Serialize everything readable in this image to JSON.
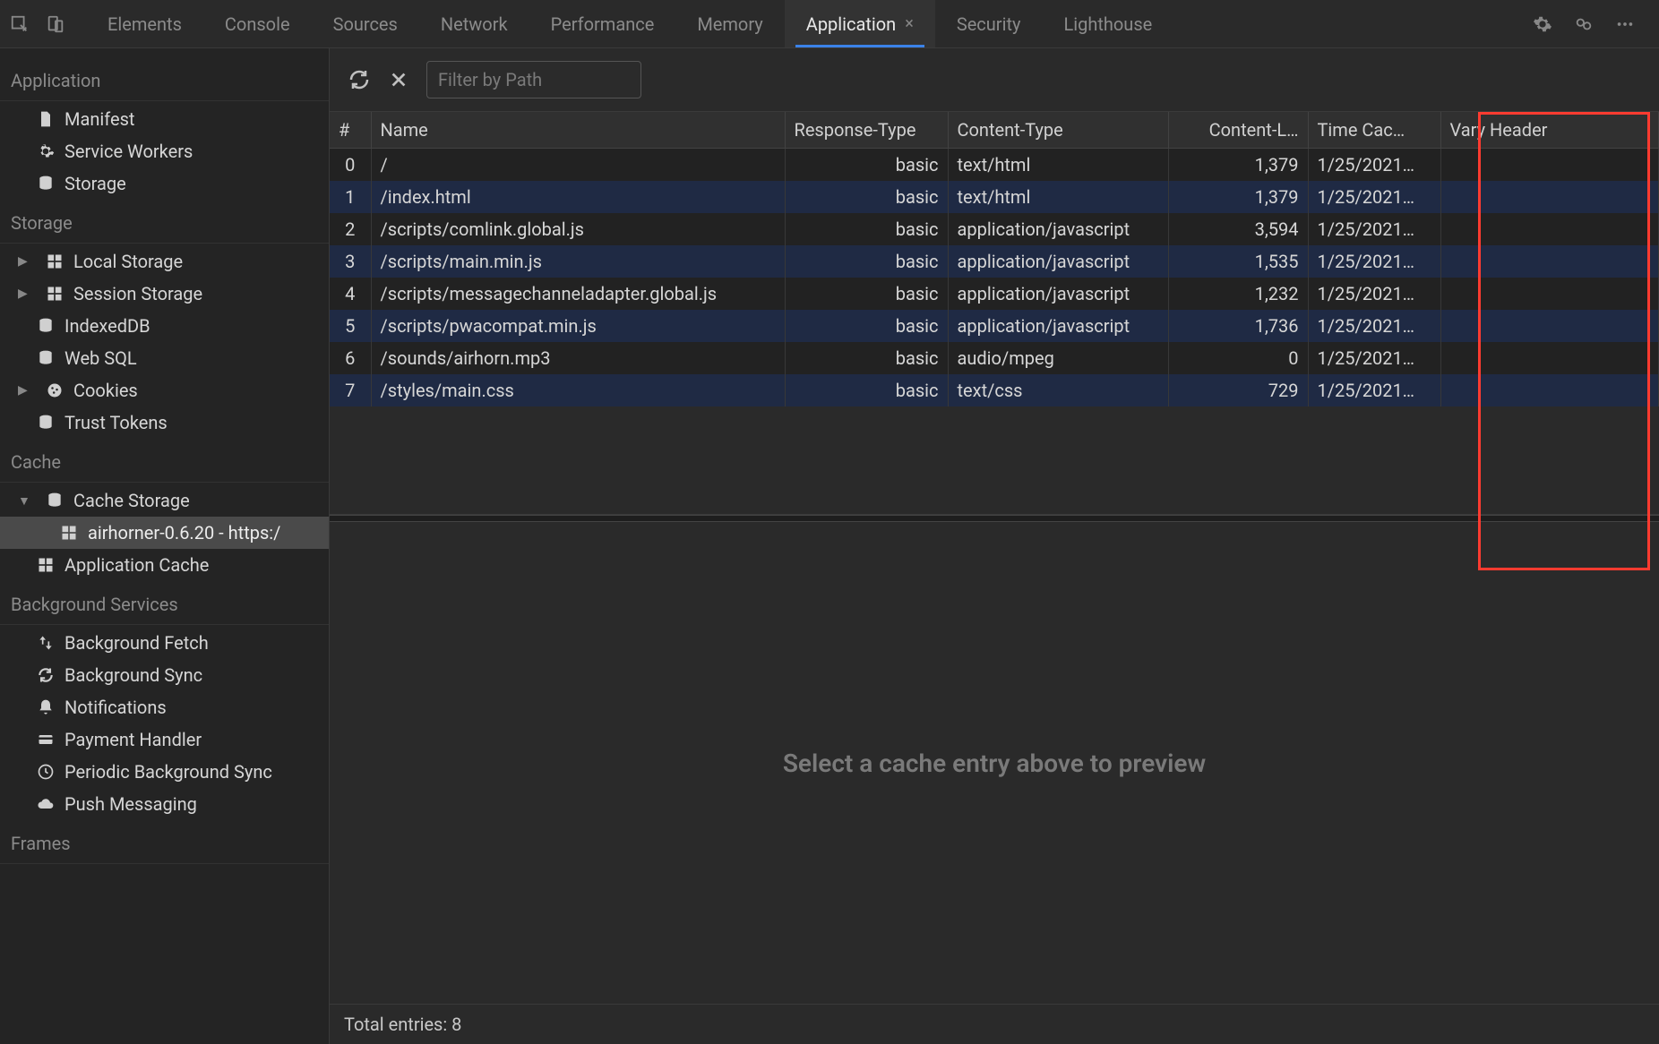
{
  "tabs": [
    "Elements",
    "Console",
    "Sources",
    "Network",
    "Performance",
    "Memory",
    "Application",
    "Security",
    "Lighthouse"
  ],
  "active_tab": "Application",
  "sidebar": {
    "sections": [
      {
        "title": "Application",
        "items": [
          {
            "icon": "file",
            "label": "Manifest"
          },
          {
            "icon": "gear",
            "label": "Service Workers"
          },
          {
            "icon": "db",
            "label": "Storage"
          }
        ]
      },
      {
        "title": "Storage",
        "items": [
          {
            "icon": "grid",
            "label": "Local Storage",
            "expandable": true
          },
          {
            "icon": "grid",
            "label": "Session Storage",
            "expandable": true
          },
          {
            "icon": "db",
            "label": "IndexedDB"
          },
          {
            "icon": "db",
            "label": "Web SQL"
          },
          {
            "icon": "cookie",
            "label": "Cookies",
            "expandable": true
          },
          {
            "icon": "db",
            "label": "Trust Tokens"
          }
        ]
      },
      {
        "title": "Cache",
        "items": [
          {
            "icon": "db",
            "label": "Cache Storage",
            "expandable": true,
            "expanded": true,
            "children": [
              {
                "icon": "grid",
                "label": "airhorner-0.6.20 - https:/",
                "selected": true
              }
            ]
          },
          {
            "icon": "grid",
            "label": "Application Cache"
          }
        ]
      },
      {
        "title": "Background Services",
        "items": [
          {
            "icon": "updown",
            "label": "Background Fetch"
          },
          {
            "icon": "sync",
            "label": "Background Sync"
          },
          {
            "icon": "bell",
            "label": "Notifications"
          },
          {
            "icon": "card",
            "label": "Payment Handler"
          },
          {
            "icon": "clock",
            "label": "Periodic Background Sync"
          },
          {
            "icon": "cloud",
            "label": "Push Messaging"
          }
        ]
      },
      {
        "title": "Frames",
        "items": []
      }
    ]
  },
  "toolbar": {
    "filter_placeholder": "Filter by Path"
  },
  "table": {
    "columns": [
      "#",
      "Name",
      "Response-Type",
      "Content-Type",
      "Content-L…",
      "Time Cac…",
      "Vary Header"
    ],
    "rows": [
      {
        "idx": "0",
        "name": "/",
        "resp": "basic",
        "ctype": "text/html",
        "clen": "1,379",
        "time": "1/25/2021…",
        "vary": ""
      },
      {
        "idx": "1",
        "name": "/index.html",
        "resp": "basic",
        "ctype": "text/html",
        "clen": "1,379",
        "time": "1/25/2021…",
        "vary": ""
      },
      {
        "idx": "2",
        "name": "/scripts/comlink.global.js",
        "resp": "basic",
        "ctype": "application/javascript",
        "clen": "3,594",
        "time": "1/25/2021…",
        "vary": ""
      },
      {
        "idx": "3",
        "name": "/scripts/main.min.js",
        "resp": "basic",
        "ctype": "application/javascript",
        "clen": "1,535",
        "time": "1/25/2021…",
        "vary": ""
      },
      {
        "idx": "4",
        "name": "/scripts/messagechanneladapter.global.js",
        "resp": "basic",
        "ctype": "application/javascript",
        "clen": "1,232",
        "time": "1/25/2021…",
        "vary": ""
      },
      {
        "idx": "5",
        "name": "/scripts/pwacompat.min.js",
        "resp": "basic",
        "ctype": "application/javascript",
        "clen": "1,736",
        "time": "1/25/2021…",
        "vary": ""
      },
      {
        "idx": "6",
        "name": "/sounds/airhorn.mp3",
        "resp": "basic",
        "ctype": "audio/mpeg",
        "clen": "0",
        "time": "1/25/2021…",
        "vary": ""
      },
      {
        "idx": "7",
        "name": "/styles/main.css",
        "resp": "basic",
        "ctype": "text/css",
        "clen": "729",
        "time": "1/25/2021…",
        "vary": ""
      }
    ]
  },
  "preview": {
    "empty_text": "Select a cache entry above to preview"
  },
  "footer": {
    "total_label": "Total entries: 8"
  }
}
